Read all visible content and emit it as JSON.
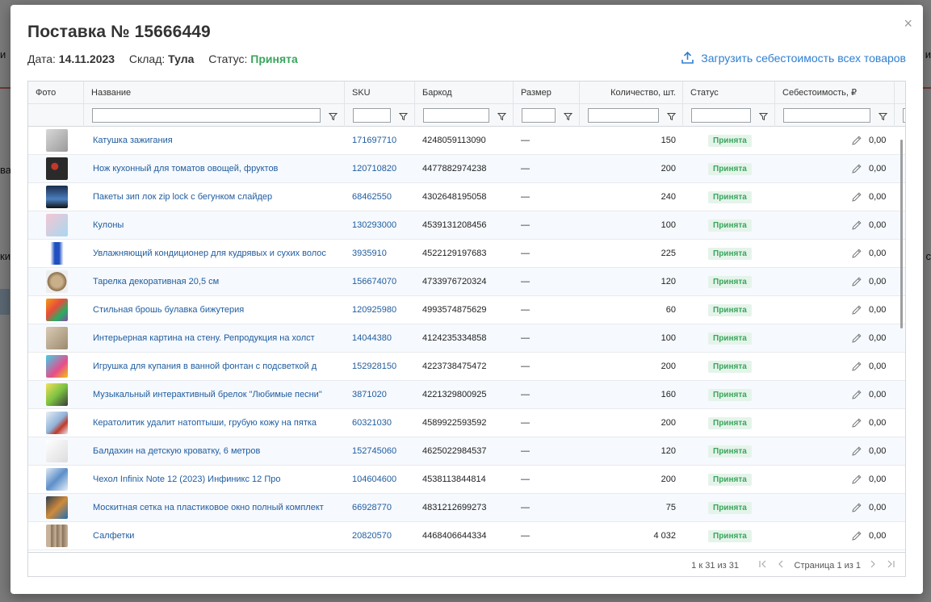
{
  "modal": {
    "title": "Поставка № 15666449",
    "date_label": "Дата:",
    "date_value": "14.11.2023",
    "warehouse_label": "Склад:",
    "warehouse_value": "Тула",
    "status_label": "Статус:",
    "status_value": "Принята",
    "upload_label": "Загрузить себестоимость всех товаров",
    "close_glyph": "×",
    "status_color": "#3aa55d",
    "link_color": "#1f5c9e"
  },
  "columns": [
    "Фото",
    "Название",
    "SKU",
    "Баркод",
    "Размер",
    "Количество, шт.",
    "Статус",
    "Себестоимость, ₽"
  ],
  "rows": [
    {
      "name": "Катушка зажигания",
      "sku": "171697710",
      "barcode": "4248059113090",
      "size": "—",
      "qty": "150",
      "status": "Принята",
      "cost": "0,00",
      "thumb": "grey-part"
    },
    {
      "name": "Нож кухонный для томатов овощей, фруктов",
      "sku": "120710820",
      "barcode": "4477882974238",
      "size": "—",
      "qty": "200",
      "status": "Принята",
      "cost": "0,00",
      "thumb": "dark-food"
    },
    {
      "name": "Пакеты зип лок zip lock с бегунком слайдер",
      "sku": "68462550",
      "barcode": "4302648195058",
      "size": "—",
      "qty": "240",
      "status": "Принята",
      "cost": "0,00",
      "thumb": "dark-blue"
    },
    {
      "name": "Кулоны",
      "sku": "130293000",
      "barcode": "4539131208456",
      "size": "—",
      "qty": "100",
      "status": "Принята",
      "cost": "0,00",
      "thumb": "pastel"
    },
    {
      "name": "Увлажняющий кондиционер для кудрявых и сухих волос",
      "sku": "3935910",
      "barcode": "4522129197683",
      "size": "—",
      "qty": "225",
      "status": "Принята",
      "cost": "0,00",
      "thumb": "blue-bottle"
    },
    {
      "name": "Тарелка декоративная 20,5 см",
      "sku": "156674070",
      "barcode": "4733976720324",
      "size": "—",
      "qty": "120",
      "status": "Принята",
      "cost": "0,00",
      "thumb": "plate"
    },
    {
      "name": "Стильная брошь булавка бижутерия",
      "sku": "120925980",
      "barcode": "4993574875629",
      "size": "—",
      "qty": "60",
      "status": "Принята",
      "cost": "0,00",
      "thumb": "colorful"
    },
    {
      "name": "Интерьерная картина на стену. Репродукция на холст",
      "sku": "14044380",
      "barcode": "4124235334858",
      "size": "—",
      "qty": "100",
      "status": "Принята",
      "cost": "0,00",
      "thumb": "beige"
    },
    {
      "name": "Игрушка для купания в ванной фонтан с подсветкой д",
      "sku": "152928150",
      "barcode": "4223738475472",
      "size": "—",
      "qty": "200",
      "status": "Принята",
      "cost": "0,00",
      "thumb": "cyan-toy"
    },
    {
      "name": "Музыкальный интерактивный брелок \"Любимые песни\"",
      "sku": "3871020",
      "barcode": "4221329800925",
      "size": "—",
      "qty": "160",
      "status": "Принята",
      "cost": "0,00",
      "thumb": "yellow-green"
    },
    {
      "name": "Кератолитик удалит натоптыши, грубую кожу на пятка",
      "sku": "60321030",
      "barcode": "4589922593592",
      "size": "—",
      "qty": "200",
      "status": "Принята",
      "cost": "0,00",
      "thumb": "cosmetic"
    },
    {
      "name": "Балдахин на детскую кроватку, 6 метров",
      "sku": "152745060",
      "barcode": "4625022984537",
      "size": "—",
      "qty": "120",
      "status": "Принята",
      "cost": "0,00",
      "thumb": "white"
    },
    {
      "name": "Чехол Infinix Note 12 (2023) Инфиникс 12 Про",
      "sku": "104604600",
      "barcode": "4538113844814",
      "size": "—",
      "qty": "200",
      "status": "Принята",
      "cost": "0,00",
      "thumb": "phone"
    },
    {
      "name": "Москитная сетка на пластиковое окно полный комплект",
      "sku": "66928770",
      "barcode": "4831212699273",
      "size": "—",
      "qty": "75",
      "status": "Принята",
      "cost": "0,00",
      "thumb": "net"
    },
    {
      "name": "Салфетки",
      "sku": "20820570",
      "barcode": "4468406644334",
      "size": "—",
      "qty": "4 032",
      "status": "Принята",
      "cost": "0,00",
      "thumb": "tubes"
    }
  ],
  "footer": {
    "summary": "1 к 31 из 31",
    "page_label": "Страница 1 из 1"
  },
  "background": {
    "left1": "и",
    "left2": "ва",
    "left3": "ки",
    "right1": "и",
    "right2": "с"
  }
}
